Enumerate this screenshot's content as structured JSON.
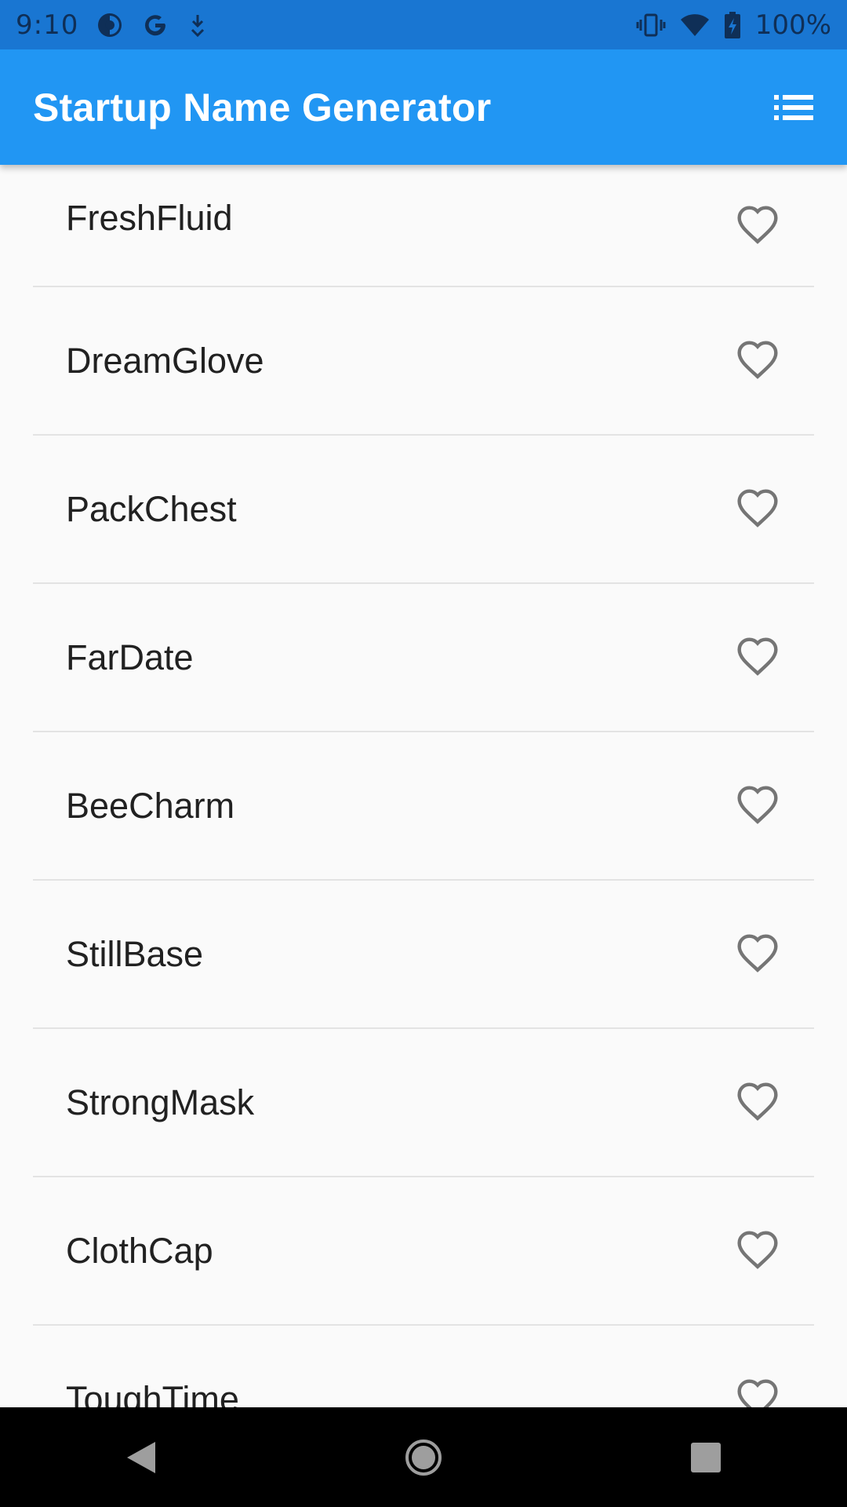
{
  "status_bar": {
    "time": "9:10",
    "battery": "100%",
    "icons": [
      "data-saver-icon",
      "google-icon",
      "download-icon",
      "vibrate-icon",
      "wifi-icon",
      "battery-charging-icon"
    ]
  },
  "app_bar": {
    "title": "Startup Name Generator",
    "action_icon": "list-icon"
  },
  "items": [
    {
      "name": "FreshFluid"
    },
    {
      "name": "DreamGlove"
    },
    {
      "name": "PackChest"
    },
    {
      "name": "FarDate"
    },
    {
      "name": "BeeCharm"
    },
    {
      "name": "StillBase"
    },
    {
      "name": "StrongMask"
    },
    {
      "name": "ClothCap"
    },
    {
      "name": "ToughTime"
    }
  ],
  "colors": {
    "status_bar": "#1976d2",
    "app_bar": "#2196f3",
    "background": "#fafafa",
    "heart_outline": "#757575",
    "nav_bar": "#000000"
  }
}
